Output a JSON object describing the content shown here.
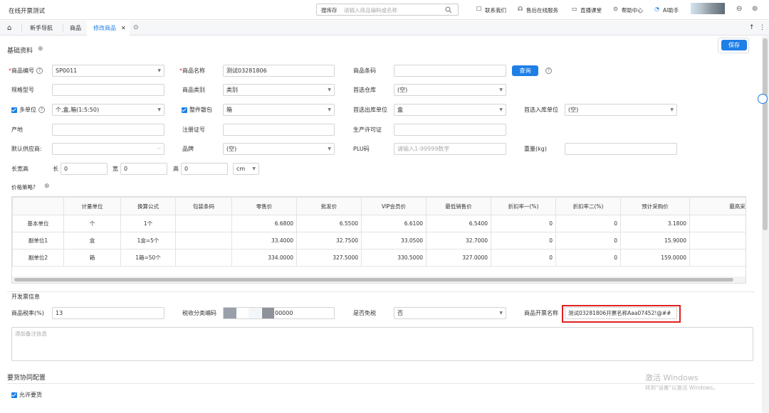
{
  "app": {
    "title": "在线开票测试"
  },
  "search": {
    "label": "搜库存",
    "placeholder": "请输入商品编码或名称"
  },
  "top_actions": [
    "联系我们",
    "售后在线服务",
    "直播课堂",
    "帮助中心",
    "AI助手"
  ],
  "tabs": [
    "新手导航",
    "商品",
    "修改商品"
  ],
  "save_label": "保存",
  "section_basic": "基础资料",
  "fields": {
    "code_label": "商品编号",
    "code_value": "SP0011",
    "name_label": "商品名称",
    "name_value": "测试03281806",
    "barcode_label": "商品条码",
    "query_label": "查询",
    "spec_label": "规格型号",
    "category_label": "商品类别",
    "category_value": "类别",
    "warehouse_label": "首选仓库",
    "warehouse_value": "(空)",
    "multiunit_label": "多单位",
    "multiunit_value": "个,盒,箱(1:5:50)",
    "whole_label": "整件散包",
    "whole_value": "箱",
    "out_unit_label": "首选出库单位",
    "out_unit_value": "盒",
    "in_unit_label": "首选入库单位",
    "in_unit_value": "(空)",
    "origin_label": "产地",
    "reg_label": "注册证号",
    "license_label": "生产许可证",
    "supplier_label": "默认供应商:",
    "brand_label": "品牌",
    "brand_value": "(空)",
    "plu_label": "PLU码",
    "plu_placeholder": "请输入1-99999数字",
    "weight_label": "重量(kg)",
    "dims_label": "长宽高",
    "len_label": "长",
    "len_value": "0",
    "wid_label": "宽",
    "wid_value": "0",
    "hei_label": "高",
    "hei_value": "0",
    "dim_unit": "cm"
  },
  "price_strategy_label": "价格策略?",
  "price_table": {
    "headers": [
      "",
      "计量单位",
      "换算公式",
      "包装条码",
      "零售价",
      "批发价",
      "VIP会员价",
      "最低销售价",
      "折扣率一(%)",
      "折扣率二(%)",
      "预计采购价",
      "最高采购价"
    ],
    "rows": [
      [
        "基本单位",
        "个",
        "1个",
        "",
        "6.6800",
        "6.5500",
        "6.6100",
        "6.5400",
        "0",
        "0",
        "3.1800",
        ""
      ],
      [
        "副单位1",
        "盒",
        "1盒=5个",
        "",
        "33.4000",
        "32.7500",
        "33.0500",
        "32.7000",
        "0",
        "0",
        "15.9000",
        ""
      ],
      [
        "副单位2",
        "箱",
        "1箱=50个",
        "",
        "334.0000",
        "327.5000",
        "330.5000",
        "327.0000",
        "0",
        "0",
        "159.0000",
        ""
      ]
    ]
  },
  "invoice": {
    "section": "开发票信息",
    "tax_label": "商品税率(%)",
    "tax_value": "13",
    "taxcode_label": "税收分类编码",
    "taxcode_value": "00000",
    "exempt_label": "是否免税",
    "exempt_value": "否",
    "invname_label": "商品开票名称",
    "invname_value": "测试03281806开票名称Aaa07452!@##",
    "remark_placeholder": "添加备注信息"
  },
  "collab": {
    "section": "要货协同配置",
    "allow_label": "允许要货"
  },
  "watermark": {
    "line1": "激活 Windows",
    "line2": "转到\"设置\"以激活 Windows。"
  },
  "colors": {
    "accent": "#1e7fe6",
    "highlight": "#e02020"
  }
}
